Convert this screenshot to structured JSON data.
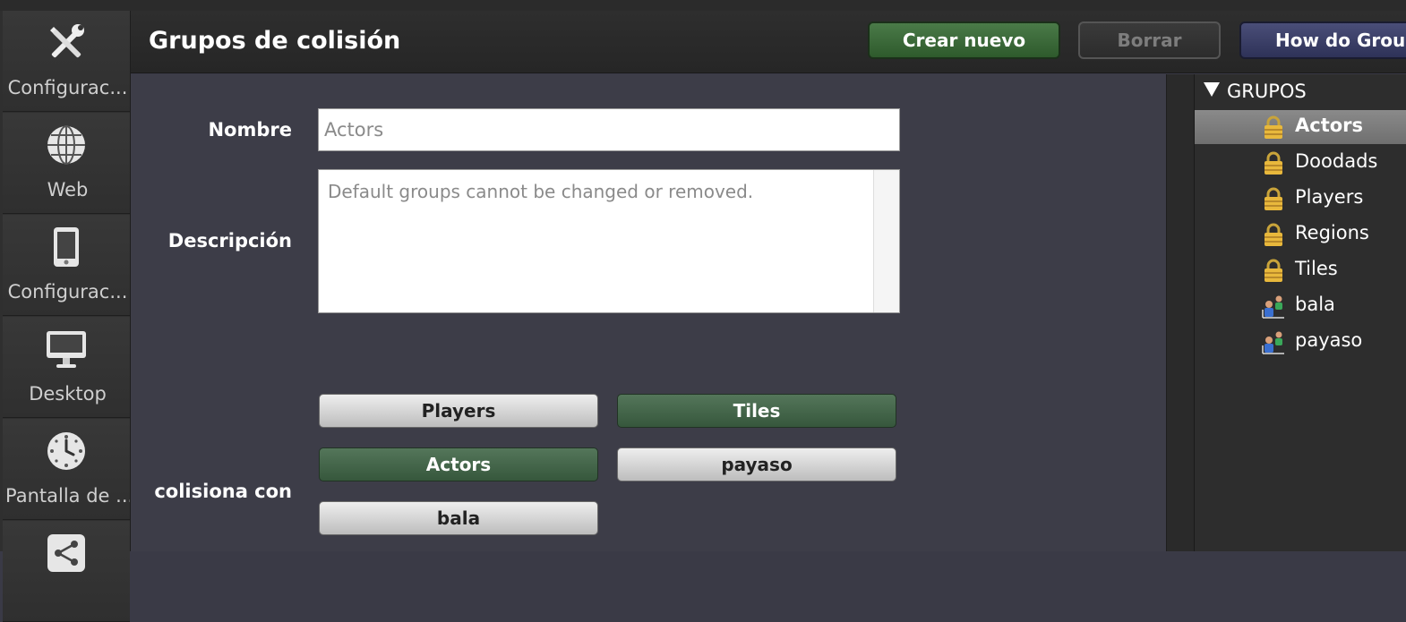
{
  "sidebar": {
    "items": [
      {
        "label": "Configurac...",
        "icon": "wrench-screwdriver-icon"
      },
      {
        "label": "Web",
        "icon": "globe-icon"
      },
      {
        "label": "Configurac...",
        "icon": "tablet-icon"
      },
      {
        "label": "Desktop",
        "icon": "monitor-icon"
      },
      {
        "label": "Pantalla de ...",
        "icon": "clock-icon"
      },
      {
        "label": "",
        "icon": "share-icon"
      }
    ]
  },
  "header": {
    "title": "Grupos de colisión",
    "new_label": "Crear nuevo",
    "delete_label": "Borrar",
    "how_label": "How do Grou"
  },
  "form": {
    "name_label": "Nombre",
    "name_value": "Actors",
    "description_label": "Descripción",
    "description_value": "Default groups cannot be changed or removed.",
    "collides_label": "colisiona con",
    "collide_groups": [
      {
        "label": "Players",
        "active": false
      },
      {
        "label": "Tiles",
        "active": true
      },
      {
        "label": "Actors",
        "active": true
      },
      {
        "label": "payaso",
        "active": false
      },
      {
        "label": "bala",
        "active": false
      }
    ]
  },
  "groups_panel": {
    "header": "GRUPOS",
    "items": [
      {
        "label": "Actors",
        "icon": "lock-icon",
        "selected": true
      },
      {
        "label": "Doodads",
        "icon": "lock-icon",
        "selected": false
      },
      {
        "label": "Players",
        "icon": "lock-icon",
        "selected": false
      },
      {
        "label": "Regions",
        "icon": "lock-icon",
        "selected": false
      },
      {
        "label": "Tiles",
        "icon": "lock-icon",
        "selected": false
      },
      {
        "label": "bala",
        "icon": "actors-group-icon",
        "selected": false
      },
      {
        "label": "payaso",
        "icon": "actors-group-icon",
        "selected": false
      }
    ]
  },
  "colors": {
    "active_toggle": "#3f6146",
    "new_button": "#3b6a39",
    "how_button": "#3a3e68",
    "selected_row": "#7c7c7c"
  }
}
